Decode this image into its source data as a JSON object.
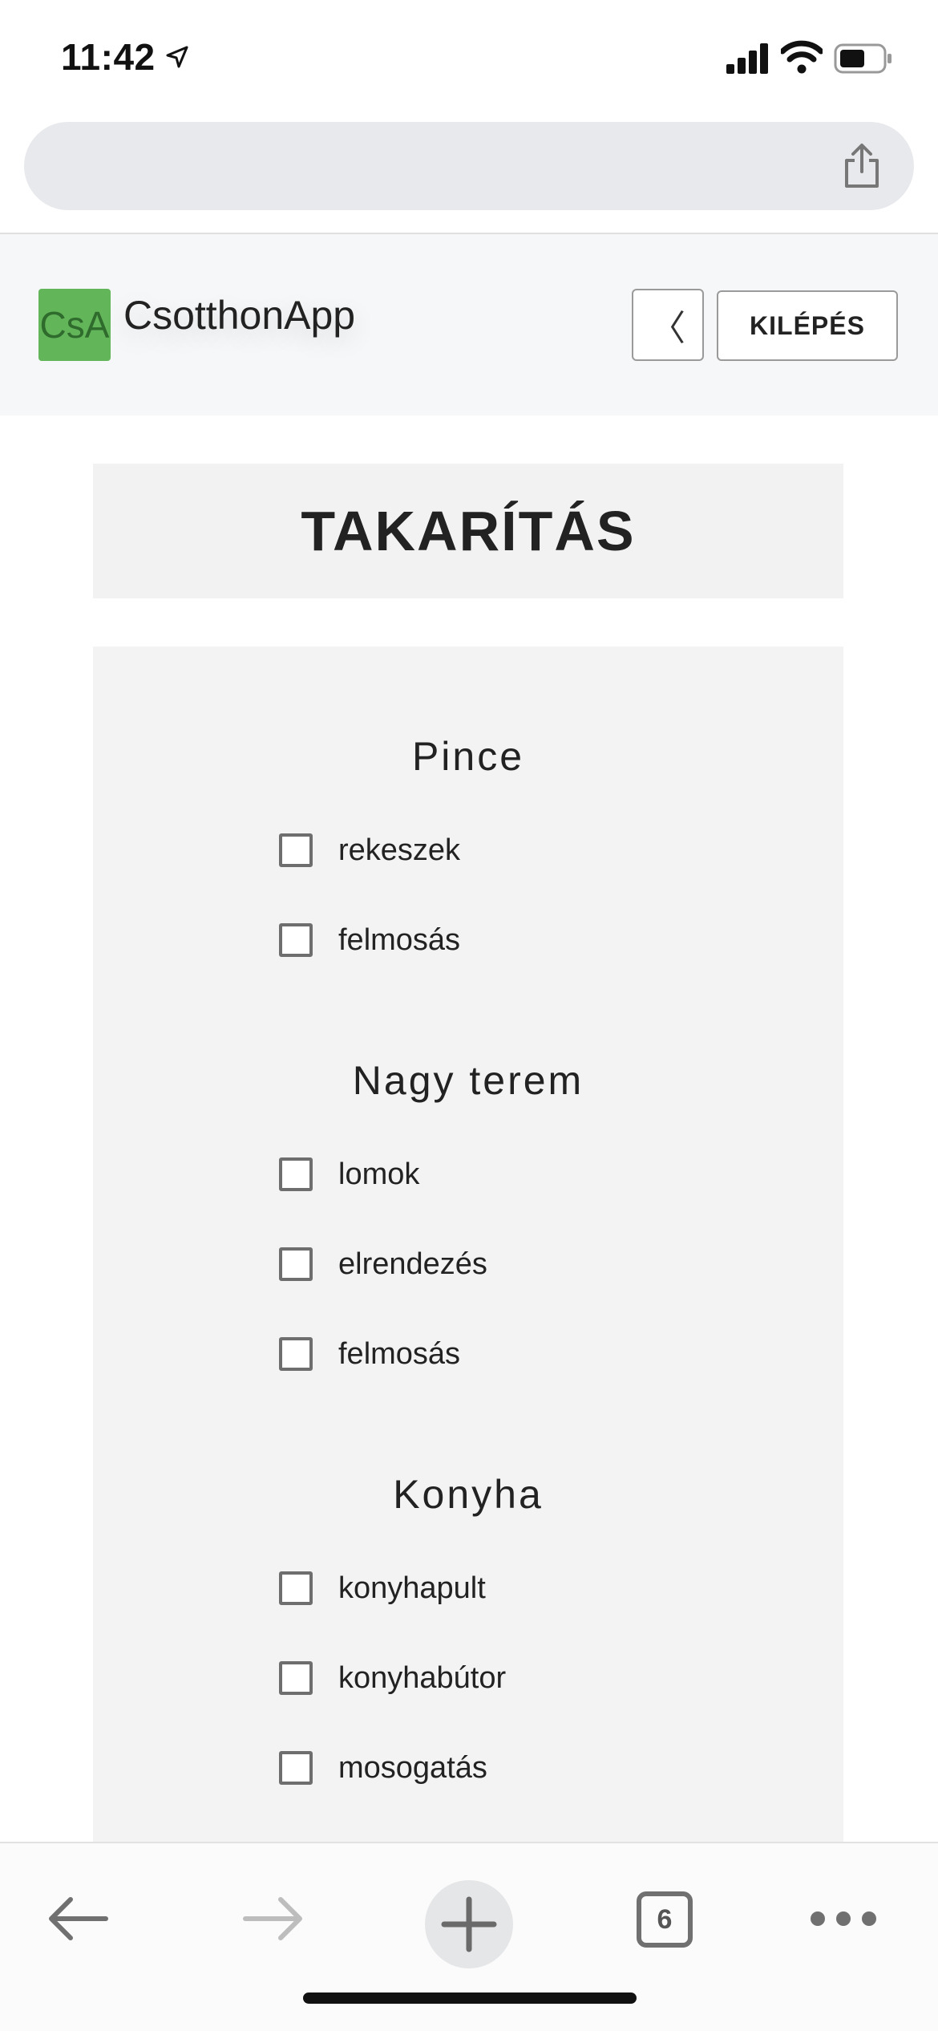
{
  "status_bar": {
    "time": "11:42",
    "icons": [
      "location-arrow-icon",
      "signal-icon",
      "wifi-icon",
      "battery-icon"
    ]
  },
  "browser": {
    "url": "",
    "share_icon": "share-icon"
  },
  "app": {
    "logo_text": "CsA",
    "brand": "CsotthonApp",
    "back_label": "〈",
    "logout_label": "KILÉPÉS",
    "colors": {
      "logo_bg": "#63b55a",
      "logo_text": "#2f6b2d"
    }
  },
  "page": {
    "title": "TAKARÍTÁS"
  },
  "sections": [
    {
      "title": "Pince",
      "tasks": [
        "rekeszek",
        "felmosás"
      ]
    },
    {
      "title": "Nagy terem",
      "tasks": [
        "lomok",
        "elrendezés",
        "felmosás"
      ]
    },
    {
      "title": "Konyha",
      "tasks": [
        "konyhapult",
        "konyhabútor",
        "mosogatás"
      ]
    }
  ],
  "toolbar": {
    "tab_count": "6",
    "icons": [
      "back-arrow-icon",
      "forward-arrow-icon",
      "plus-icon",
      "tabs-icon",
      "more-icon"
    ]
  }
}
